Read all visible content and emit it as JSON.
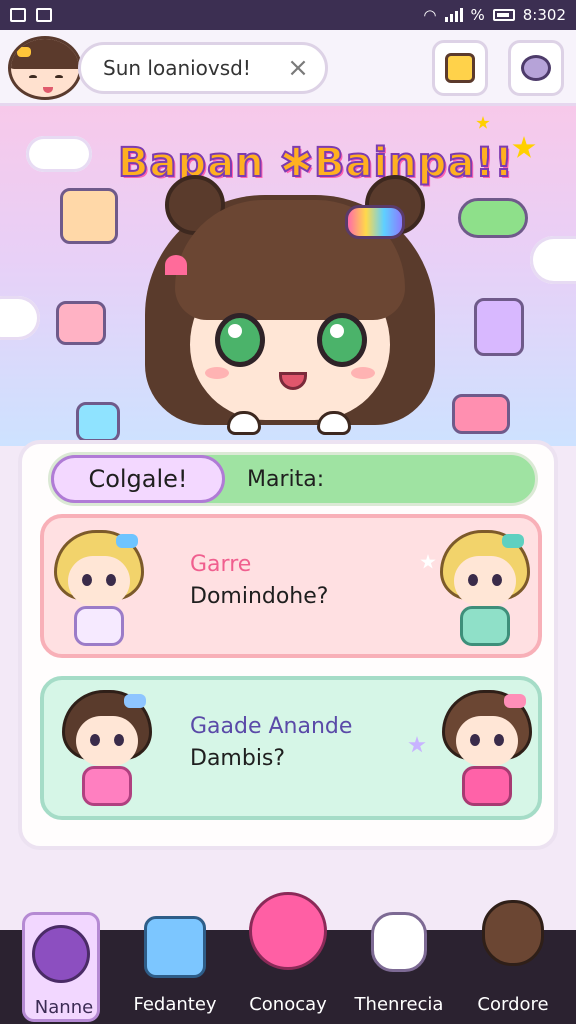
{
  "status_bar": {
    "time": "8:302",
    "battery_percent": "%"
  },
  "header": {
    "search_value": "Sun loaniovsd!",
    "clear_label": "×"
  },
  "hero": {
    "title": "Bapan ✱Bainpa!!"
  },
  "tabs": {
    "active": "Colgale!",
    "inactive": "Marita:"
  },
  "cards": [
    {
      "line1": "Garre",
      "line2": "Domindohe?"
    },
    {
      "line1": "Gaade Anande",
      "line2": "Dambis?"
    }
  ],
  "nav": {
    "items": [
      {
        "label": "Nanne",
        "active": true
      },
      {
        "label": "Fedantey",
        "active": false
      },
      {
        "label": "Conocay",
        "active": false
      },
      {
        "label": "Thenrecia",
        "active": false
      },
      {
        "label": "Cordore",
        "active": false
      }
    ]
  },
  "colors": {
    "accent": "#b07bd6",
    "tab_active_bg": "#f3d8ff",
    "tab_bar_bg": "#9fe3a2",
    "card_pink": "#ffe0e2",
    "card_mint": "#d6f6e7",
    "nav_bg": "#2b2230"
  }
}
